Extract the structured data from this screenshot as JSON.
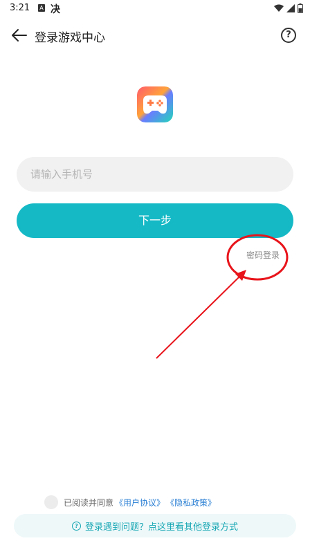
{
  "status_bar": {
    "time": "3:21",
    "icon_a": "A",
    "icon_b": "决",
    "icons": [
      "wifi-icon",
      "signal-icon",
      "battery-icon"
    ]
  },
  "header": {
    "title": "登录游戏中心",
    "help_symbol": "?"
  },
  "login": {
    "phone_placeholder": "请输入手机号",
    "phone_value": "",
    "next_label": "下一步",
    "password_login_label": "密码登录"
  },
  "agreement": {
    "text": "已阅读并同意",
    "user_agreement": "《用户协议》",
    "privacy_policy": "《隐私政策》"
  },
  "help_bar": {
    "icon": "?",
    "text": "登录遇到问题？点这里看其他登录方式"
  },
  "colors": {
    "accent": "#15b9c6",
    "link": "#2a7fd4",
    "annotation": "#e8141b"
  }
}
